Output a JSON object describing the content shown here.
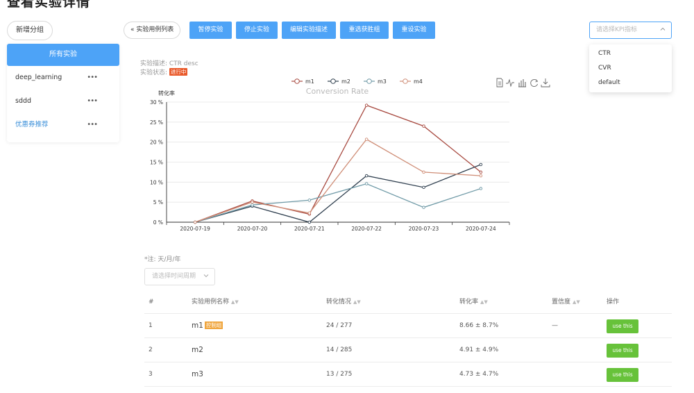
{
  "page": {
    "title": "查看实验详情"
  },
  "sidebar": {
    "new_group_label": "新增分组",
    "all_label": "所有实验",
    "items": [
      {
        "label": "deep_learning"
      },
      {
        "label": "sddd"
      },
      {
        "label": "优惠券推荐"
      }
    ],
    "more_glyph": "•••"
  },
  "toolbar": {
    "back_label": "« 实验用例列表",
    "pause_label": "暂停实验",
    "stop_label": "停止实验",
    "edit_label": "编辑实验描述",
    "reselect_label": "重选获胜组",
    "reset_label": "重设实验"
  },
  "kpi": {
    "placeholder": "请选择KPI指标",
    "options": [
      "CTR",
      "CVR",
      "default"
    ]
  },
  "experiment": {
    "desc_label": "实验描述: CTR desc",
    "status_label": "实验状态:",
    "status_value": "进行中"
  },
  "chart_data": {
    "type": "line",
    "title": "Conversion Rate",
    "ylabel": "转化率",
    "xlabel": "",
    "categories": [
      "2020-07-19",
      "2020-07-20",
      "2020-07-21",
      "2020-07-22",
      "2020-07-23",
      "2020-07-24"
    ],
    "ylim": [
      0,
      30
    ],
    "yticks": [
      0,
      5,
      10,
      15,
      20,
      25,
      30
    ],
    "ytick_suffix": " %",
    "grid": true,
    "legend": "top-center",
    "toolbox": [
      "data-view-icon",
      "line-chart-icon",
      "bar-chart-icon",
      "restore-icon",
      "download-icon"
    ],
    "series": [
      {
        "name": "m1",
        "color": "#a84a40",
        "values": [
          0,
          5.3,
          2.0,
          29.2,
          24.0,
          12.5
        ]
      },
      {
        "name": "m2",
        "color": "#2e3e4e",
        "values": [
          0,
          4.0,
          0,
          11.6,
          8.7,
          14.4
        ]
      },
      {
        "name": "m3",
        "color": "#6e99a6",
        "values": [
          0,
          4.3,
          5.5,
          9.6,
          3.7,
          8.4
        ]
      },
      {
        "name": "m4",
        "color": "#cf8d76",
        "values": [
          0,
          5.0,
          2.3,
          20.7,
          12.5,
          11.6
        ]
      }
    ]
  },
  "note": "*注: 天/月/年",
  "period": {
    "placeholder": "请选择时间周期"
  },
  "table": {
    "headers": [
      "#",
      "实验用例名称",
      "转化情况",
      "转化率",
      "置信度",
      "操作"
    ],
    "rows": [
      {
        "index": "1",
        "name": "m1",
        "badge": "控制组",
        "conversion": "24 / 277",
        "rate": "8.66 ± 8.7%",
        "confidence": "—",
        "action": "use this"
      },
      {
        "index": "2",
        "name": "m2",
        "badge": "",
        "conversion": "14 / 285",
        "rate": "4.91 ± 4.9%",
        "confidence": "",
        "action": "use this"
      },
      {
        "index": "3",
        "name": "m3",
        "badge": "",
        "conversion": "13 / 275",
        "rate": "4.73 ± 4.7%",
        "confidence": "",
        "action": "use this"
      }
    ]
  }
}
